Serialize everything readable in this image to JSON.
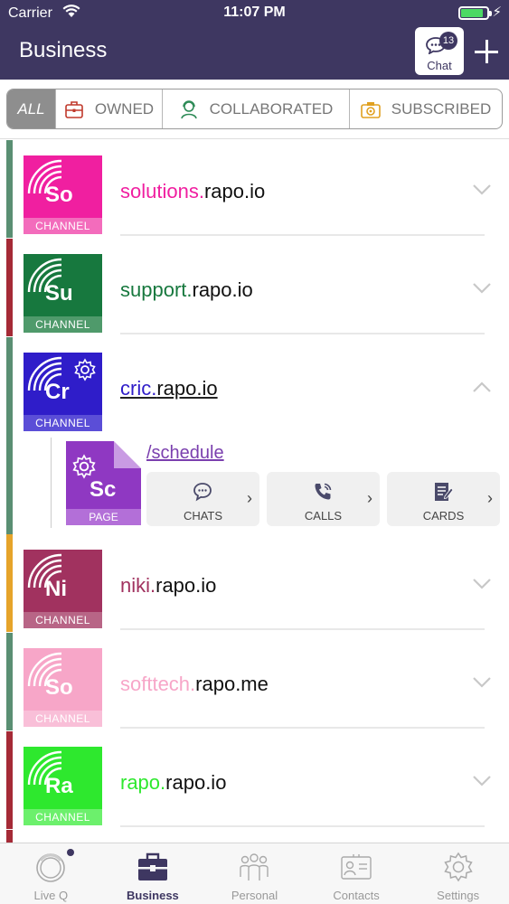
{
  "status_bar": {
    "carrier": "Carrier",
    "time": "11:07 PM"
  },
  "header": {
    "title": "Business",
    "chat_label": "Chat",
    "chat_badge": "13"
  },
  "filters": [
    {
      "label": "ALL",
      "active": true
    },
    {
      "label": "OWNED",
      "icon": "briefcase-lock-icon"
    },
    {
      "label": "COLLABORATED",
      "icon": "collaborator-icon"
    },
    {
      "label": "SUBSCRIBED",
      "icon": "subscribed-camera-icon"
    }
  ],
  "channels": [
    {
      "prefix": "solutions.",
      "suffix": "rapo.io",
      "abbr": "So",
      "tag": "CHANNEL",
      "color": "#f01fa0",
      "foot": "#f36cbc",
      "bar": "#5a8f73"
    },
    {
      "prefix": "support.",
      "suffix": "rapo.io",
      "abbr": "Su",
      "tag": "CHANNEL",
      "color": "#17783e",
      "foot": "#4f9a6b",
      "bar": "#a52a36"
    },
    {
      "prefix": "cric.",
      "suffix": "rapo.io",
      "abbr": "Cr",
      "tag": "CHANNEL",
      "color": "#2f1dc9",
      "foot": "#5b4ed7",
      "bar": "#5a8f73",
      "expanded": true
    },
    {
      "prefix": "niki.",
      "suffix": "rapo.io",
      "abbr": "Ni",
      "tag": "CHANNEL",
      "color": "#a1325f",
      "foot": "#b86586",
      "bar": "#e6a42a"
    },
    {
      "prefix": "softtech.",
      "suffix": "rapo.me",
      "abbr": "So",
      "tag": "CHANNEL",
      "color": "#f7a6c8",
      "foot": "#f9bfd8",
      "bar": "#5a8f73"
    },
    {
      "prefix": "rapo.",
      "suffix": "rapo.io",
      "abbr": "Ra",
      "tag": "CHANNEL",
      "color": "#2ee82e",
      "foot": "#6cf06c",
      "bar": "#a52a36"
    }
  ],
  "page": {
    "abbr": "Sc",
    "tag": "PAGE",
    "path": "/schedule",
    "actions": [
      {
        "label": "CHATS",
        "icon": "chat-bubble-icon"
      },
      {
        "label": "CALLS",
        "icon": "phone-icon"
      },
      {
        "label": "CARDS",
        "icon": "card-edit-icon"
      }
    ]
  },
  "tabs": [
    {
      "label": "Live Q",
      "icon": "live-q-icon"
    },
    {
      "label": "Business",
      "icon": "briefcase-icon",
      "active": true
    },
    {
      "label": "Personal",
      "icon": "people-icon"
    },
    {
      "label": "Contacts",
      "icon": "contact-card-icon"
    },
    {
      "label": "Settings",
      "icon": "gear-icon"
    }
  ]
}
